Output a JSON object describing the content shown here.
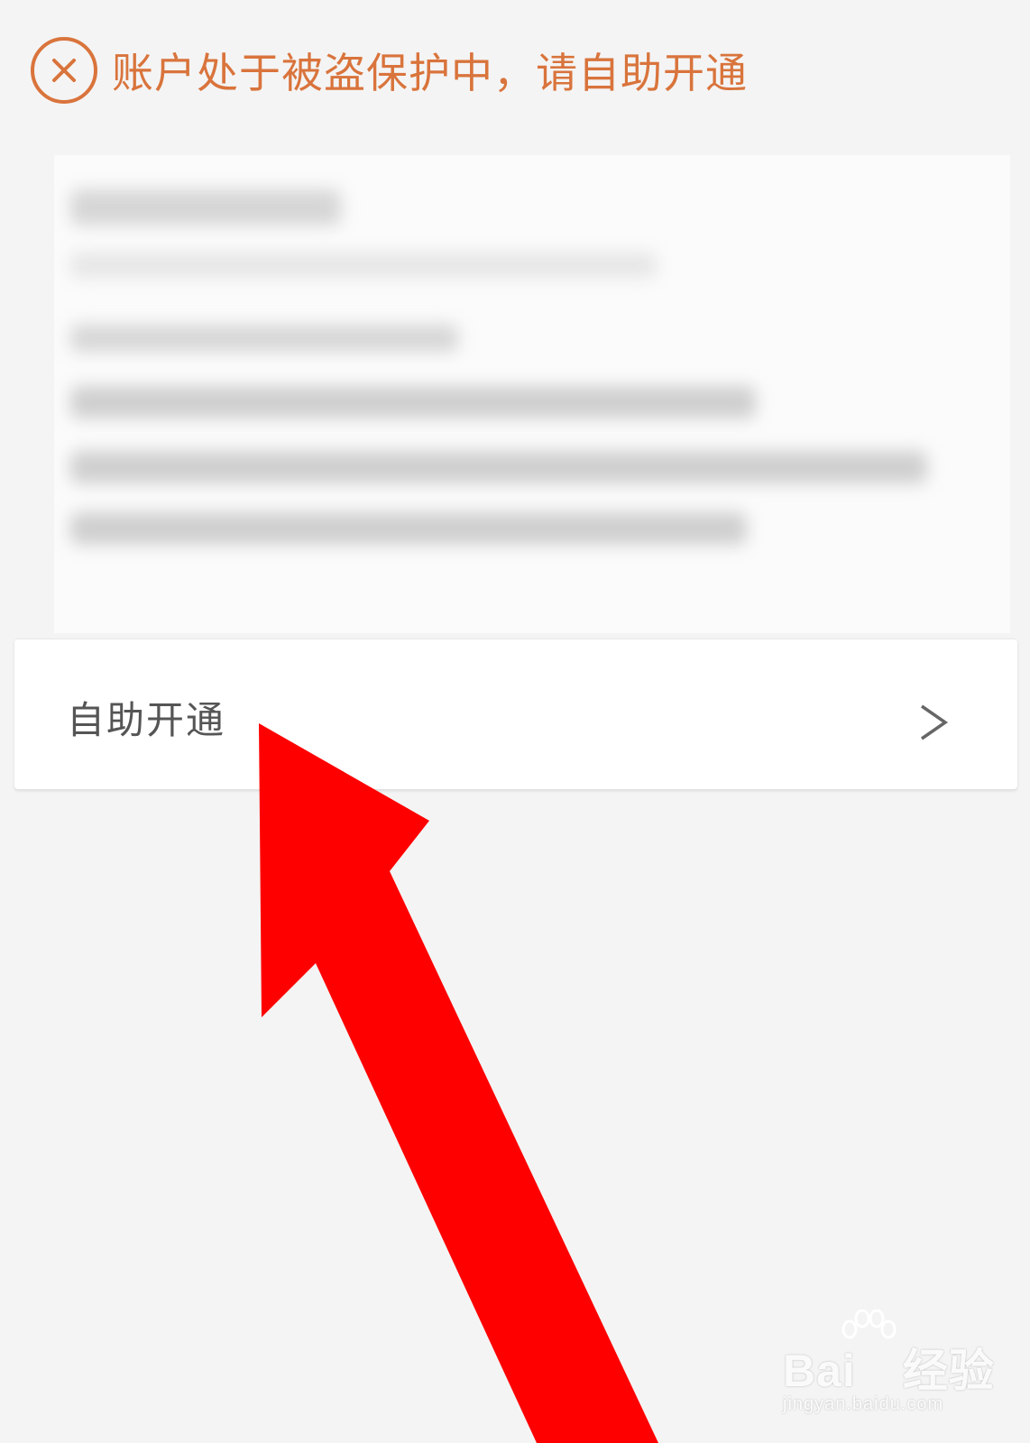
{
  "status_banner": {
    "icon": "close-circle-icon",
    "text": "账户处于被盗保护中，请自助开通",
    "color": "#d9743c"
  },
  "action_row": {
    "label": "自助开通",
    "chevron": ">",
    "icon": "chevron-right-icon"
  },
  "overlay": {
    "arrow_color": "#ff0000",
    "icon": "red-arrow-pointer"
  },
  "watermark": {
    "brand": "Bai",
    "brand_suffix": "经验",
    "paw_icon": "baidu-paw-icon",
    "url": "jingyan.baidu.com"
  }
}
